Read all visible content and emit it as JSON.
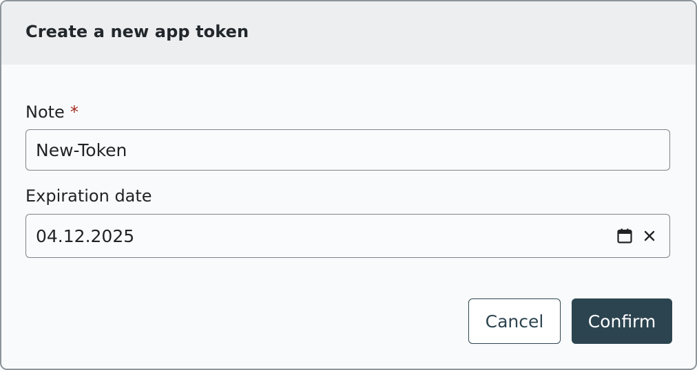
{
  "dialog": {
    "title": "Create a new app token"
  },
  "fields": {
    "note": {
      "label": "Note",
      "required_marker": "*",
      "value": "New-Token"
    },
    "expiration": {
      "label": "Expiration date",
      "value": "04.12.2025",
      "icons": [
        "calendar-icon",
        "clear-icon"
      ]
    }
  },
  "actions": {
    "cancel_label": "Cancel",
    "confirm_label": "Confirm"
  },
  "colors": {
    "primary": "#2c4450",
    "required": "#a52a1e",
    "header_bg": "#edeef0"
  }
}
